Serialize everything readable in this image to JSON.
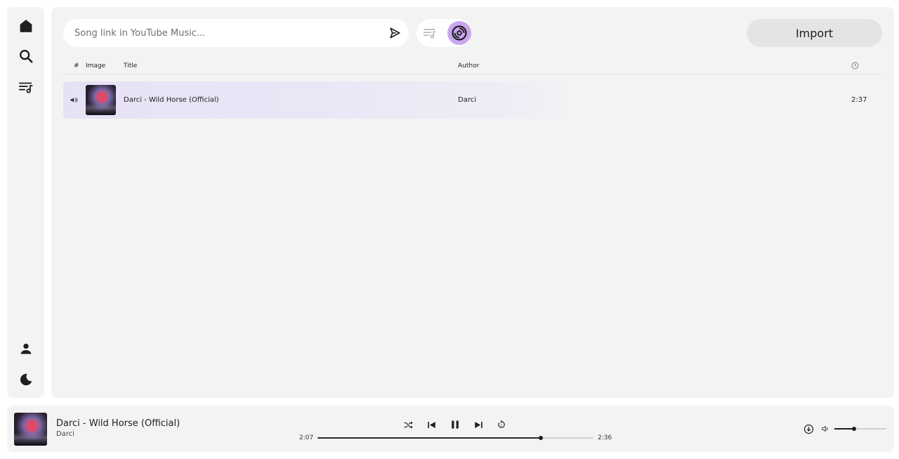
{
  "sidebar": {
    "top_items": [
      {
        "name": "home",
        "icon": "home-icon"
      },
      {
        "name": "search",
        "icon": "search-icon"
      },
      {
        "name": "playlists",
        "icon": "playlist-icon"
      }
    ],
    "bottom_items": [
      {
        "name": "profile",
        "icon": "user-icon"
      },
      {
        "name": "theme",
        "icon": "moon-icon"
      }
    ]
  },
  "search": {
    "placeholder": "Song link in YouTube Music...",
    "value": ""
  },
  "mode": {
    "active": "disc",
    "accent_color": "#c9a6f0"
  },
  "toolbar": {
    "import_label": "Import"
  },
  "table": {
    "headers": {
      "number": "#",
      "image": "Image",
      "title": "Title",
      "author": "Author",
      "duration_icon": "clock-icon"
    },
    "rows": [
      {
        "playing": true,
        "title": "Darci - Wild Horse (Official)",
        "author": "Darci",
        "duration": "2:37"
      }
    ]
  },
  "player": {
    "title": "Darci - Wild Horse (Official)",
    "artist": "Darci",
    "current_time": "2:07",
    "total_time": "2:36",
    "progress": 0.81,
    "volume": 0.38,
    "state": "playing"
  }
}
